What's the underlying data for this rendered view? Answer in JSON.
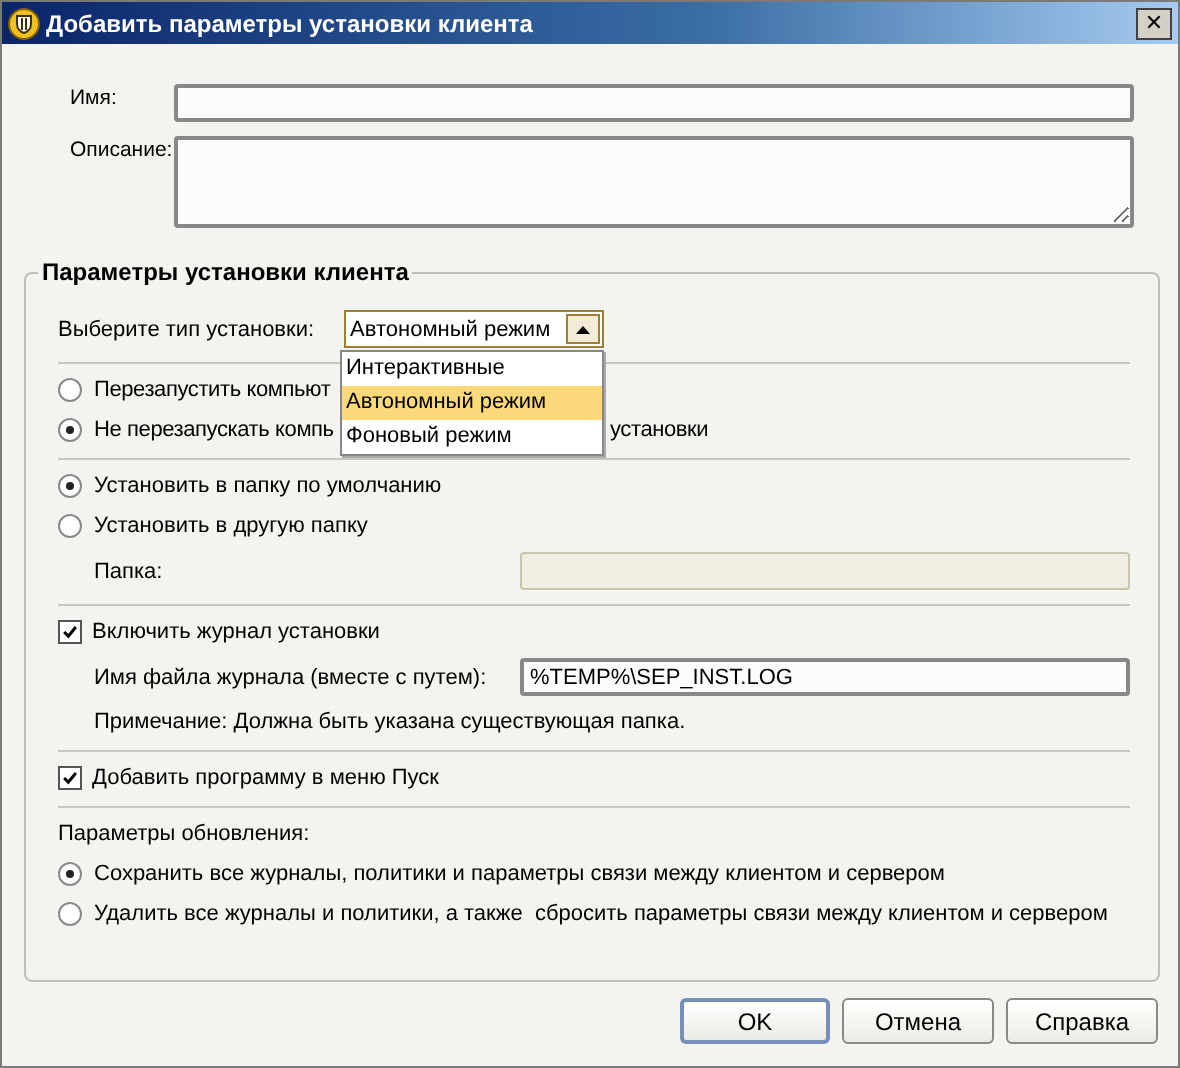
{
  "window": {
    "title": "Добавить параметры установки клиента",
    "close": "✕"
  },
  "fields": [
    {
      "kind": "line",
      "label": "Имя:"
    },
    {
      "kind": "area",
      "label": "Описание:"
    }
  ],
  "group": {
    "title": "Параметры установки клиента"
  },
  "install_type": {
    "label": "Выберите тип установки:",
    "value": "Автономный режим",
    "expanded": true,
    "options": [
      {
        "label": "Интерактивные",
        "selected": false
      },
      {
        "label": "Автономный режим",
        "selected": true
      },
      {
        "label": "Фоновый режим",
        "selected": false
      }
    ]
  },
  "restart_options": [
    {
      "parts": [
        "Перезапустить компьют"
      ],
      "selected": false
    },
    {
      "parts": [
        "Не перезапускать компь",
        "установки"
      ],
      "selected": true
    }
  ],
  "folder_options": [
    {
      "label": "Установить в папку по умолчанию",
      "selected": true
    },
    {
      "label": "Установить в другую папку",
      "selected": false
    }
  ],
  "folder": {
    "label": "Папка:",
    "disabled": true
  },
  "log": {
    "label": "Включить журнал установки",
    "checked": true,
    "file_label": "Имя файла журнала (вместе с путем):",
    "file_value": "%TEMP%\\SEP_INST.LOG",
    "note": "Примечание: Должна быть указана существующая папка."
  },
  "start_menu": {
    "label": "Добавить программу в меню Пуск",
    "checked": true
  },
  "update": {
    "label": "Параметры обновления:",
    "options": [
      {
        "label": "Сохранить все журналы, политики и параметры связи между клиентом и сервером",
        "selected": true
      },
      {
        "label": "Удалить все журналы и политики, а также  сбросить параметры связи между клиентом и сервером",
        "selected": false
      }
    ]
  },
  "buttons": [
    {
      "label": "OK",
      "default": true
    },
    {
      "label": "Отмена",
      "default": false
    },
    {
      "label": "Справка",
      "default": false
    }
  ]
}
